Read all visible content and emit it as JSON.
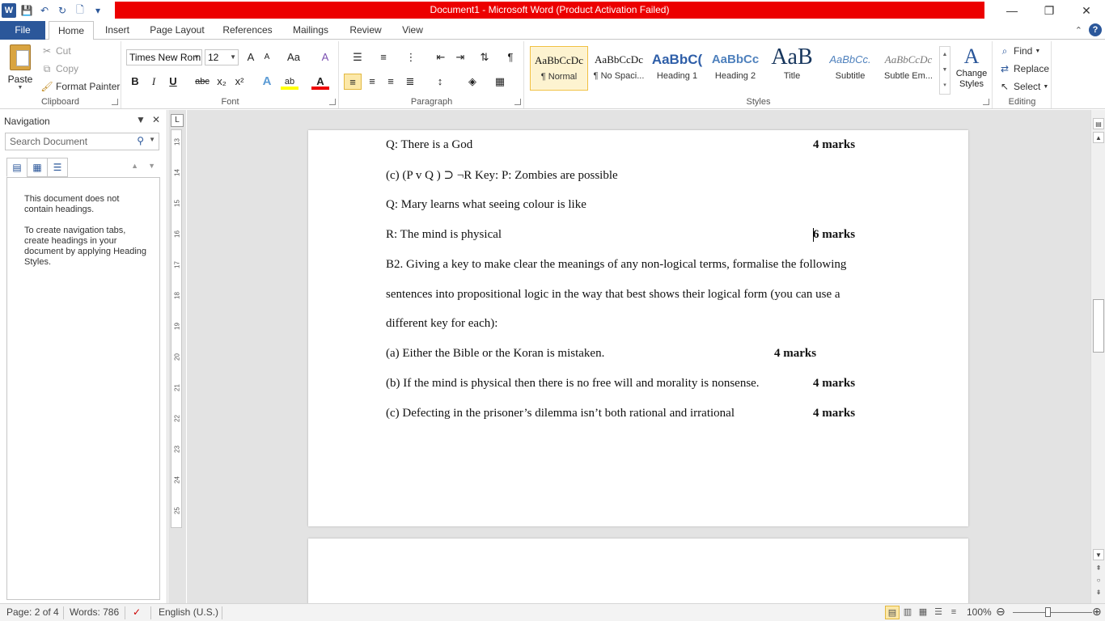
{
  "window": {
    "title": "Document1  -  Microsoft Word (Product Activation Failed)",
    "minimize": "—",
    "restore": "❐",
    "close": "✕"
  },
  "qat": {
    "logo": "W",
    "save": "💾",
    "undo": "↶",
    "redo": "↻",
    "new": "🗋",
    "more": "▾"
  },
  "tabs": [
    "File",
    "Home",
    "Insert",
    "Page Layout",
    "References",
    "Mailings",
    "Review",
    "View"
  ],
  "tab_right": {
    "collapse": "⌃",
    "help": "?"
  },
  "ribbon": {
    "clipboard": {
      "label": "Clipboard",
      "paste": "Paste",
      "cut": "Cut",
      "copy": "Copy",
      "format_painter": "Format Painter"
    },
    "font": {
      "label": "Font",
      "font_name": "Times New Rom",
      "font_size": "12",
      "grow": "A",
      "shrink": "A",
      "case": "Aa",
      "clear": "A",
      "bold": "B",
      "italic": "I",
      "underline": "U",
      "strike": "abc",
      "sub": "x₂",
      "sup": "x²",
      "effects": "A",
      "highlight": "ab",
      "color": "A"
    },
    "paragraph": {
      "label": "Paragraph",
      "pilcrow": "¶"
    },
    "styles": {
      "label": "Styles",
      "items": [
        {
          "sample": "AaBbCcDc",
          "name": "¶ Normal"
        },
        {
          "sample": "AaBbCcDc",
          "name": "¶ No Spaci..."
        },
        {
          "sample": "AaBbC(",
          "name": "Heading 1"
        },
        {
          "sample": "AaBbCc",
          "name": "Heading 2"
        },
        {
          "sample": "AaB",
          "name": "Title"
        },
        {
          "sample": "AaBbCc.",
          "name": "Subtitle"
        },
        {
          "sample": "AaBbCcDc",
          "name": "Subtle Em..."
        }
      ],
      "change": "Change Styles"
    },
    "editing": {
      "label": "Editing",
      "find": "Find",
      "replace": "Replace",
      "select": "Select"
    }
  },
  "navigation": {
    "title": "Navigation",
    "search_placeholder": "Search Document",
    "msg1": "This document does not contain headings.",
    "msg2": "To create navigation tabs, create headings in your document by applying Heading Styles."
  },
  "document": {
    "lines": [
      "Q: There is a God",
      "(c) (P v Q ) ⊃ ¬R Key: P: Zombies are possible",
      "Q: Mary learns what seeing colour is like",
      "R: The mind is physical",
      "B2. Giving a key to make clear the meanings of any non-logical terms, formalise the following",
      "sentences into propositional logic in the way that best shows their logical form (you can use a",
      "different key for each):",
      "(a) Either the Bible or the Koran is mistaken.",
      "(b) If the mind is physical then there is no free will and morality is nonsense.",
      "(c) Defecting in the prisoner’s dilemma isn’t both rational and irrational"
    ],
    "marks": [
      "4 marks",
      "6 marks",
      "4 marks",
      "4 marks",
      "4 marks"
    ]
  },
  "status": {
    "page": "Page: 2 of 4",
    "words": "Words: 786",
    "language": "English (U.S.)",
    "zoom": "100%"
  }
}
